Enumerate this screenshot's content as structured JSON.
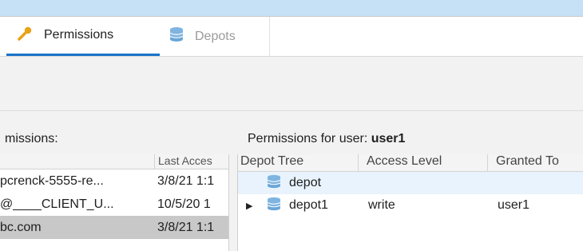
{
  "tabs": [
    {
      "label": "Permissions",
      "icon": "key-icon",
      "active": true,
      "color": "#e8a317"
    },
    {
      "label": "Depots",
      "icon": "database-icon",
      "active": false,
      "color": "#7fb4e0"
    }
  ],
  "users_panel": {
    "title": "missions:",
    "columns": [
      "",
      "Last Acces"
    ],
    "rows": [
      {
        "user": "pcrenck-5555-re...",
        "last_access": "3/8/21 1:1",
        "selected": false
      },
      {
        "user": "@____CLIENT_U...",
        "last_access": "10/5/20 1",
        "selected": false
      },
      {
        "user": "bc.com",
        "last_access": "3/8/21 1:1",
        "selected": true
      }
    ]
  },
  "permissions_panel": {
    "title_prefix": "Permissions for user:",
    "user": "user1",
    "columns": [
      "Depot Tree",
      "Access Level",
      "Granted To"
    ],
    "rows": [
      {
        "depot": "depot",
        "access": "",
        "granted_to": "",
        "expandable": false
      },
      {
        "depot": "depot1",
        "access": "write",
        "granted_to": "user1",
        "expandable": true
      }
    ]
  },
  "colors": {
    "accent": "#1a73c9",
    "selection": "#c8c8c8",
    "row_highlight": "#e8f3fd"
  }
}
